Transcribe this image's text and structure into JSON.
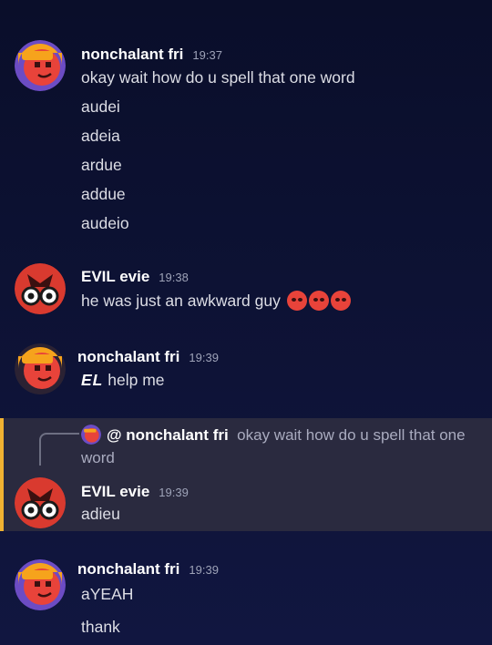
{
  "messages": [
    {
      "author": "nonchalant fri",
      "time": "19:37",
      "lines": [
        "okay wait how do u spell that one word",
        "audei",
        "adeia",
        "ardue",
        "addue",
        "audeio"
      ]
    },
    {
      "author": "EVIL evie",
      "time": "19:38",
      "text": "he was just an awkward guy",
      "emojis": [
        "pleading-face",
        "pleading-face",
        "pleading-face"
      ]
    },
    {
      "author": "nonchalant fri",
      "time": "19:39",
      "emote": "EL",
      "text": "help me"
    },
    {
      "reply_to_author": "@ nonchalant fri",
      "reply_to_text": "okay wait how do u spell that one word",
      "author": "EVIL evie",
      "time": "19:39",
      "text": "adieu"
    },
    {
      "author": "nonchalant fri",
      "time": "19:39",
      "lines": [
        "aYEAH",
        "thank"
      ]
    }
  ],
  "colors": {
    "reply_accent": "#f0b232",
    "background": "#0d1234"
  }
}
